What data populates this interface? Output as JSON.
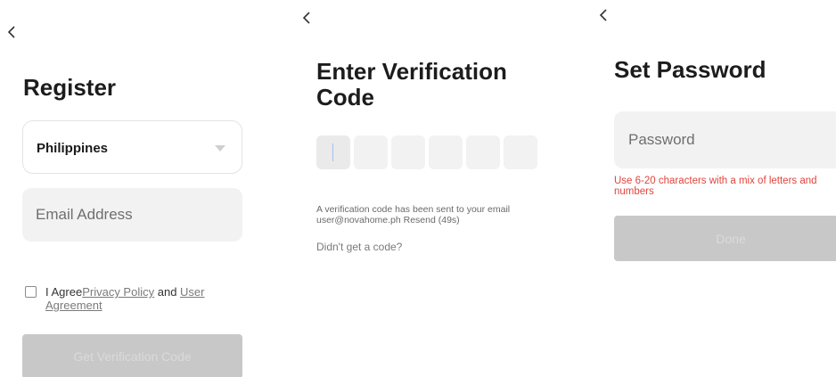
{
  "register": {
    "title": "Register",
    "country": "Philippines",
    "email_placeholder": "Email Address",
    "agree_prefix": "I Agree",
    "privacy_link": "Privacy Policy",
    "and_text": " and ",
    "user_agreement_link": "User Agreement",
    "checkbox_checked": false,
    "get_code_button": "Get Verification Code"
  },
  "verify": {
    "title": "Enter Verification Code",
    "code_digits": [
      "",
      "",
      "",
      "",
      "",
      ""
    ],
    "sent_message": "A verification code has been sent to your email user@novahome.ph Resend (49s)",
    "no_code_link": "Didn't get a code?"
  },
  "password": {
    "title": "Set Password",
    "password_placeholder": "Password",
    "error_message": "Use 6-20 characters with a mix of letters and numbers",
    "done_button": "Done"
  },
  "colors": {
    "error": "#e0443b",
    "disabled_button": "#c8c8c8",
    "field_bg": "#f2f2f2"
  },
  "icons": {
    "back": "chevron-left-icon",
    "dropdown": "caret-down-icon",
    "checkbox": "checkbox-icon"
  }
}
